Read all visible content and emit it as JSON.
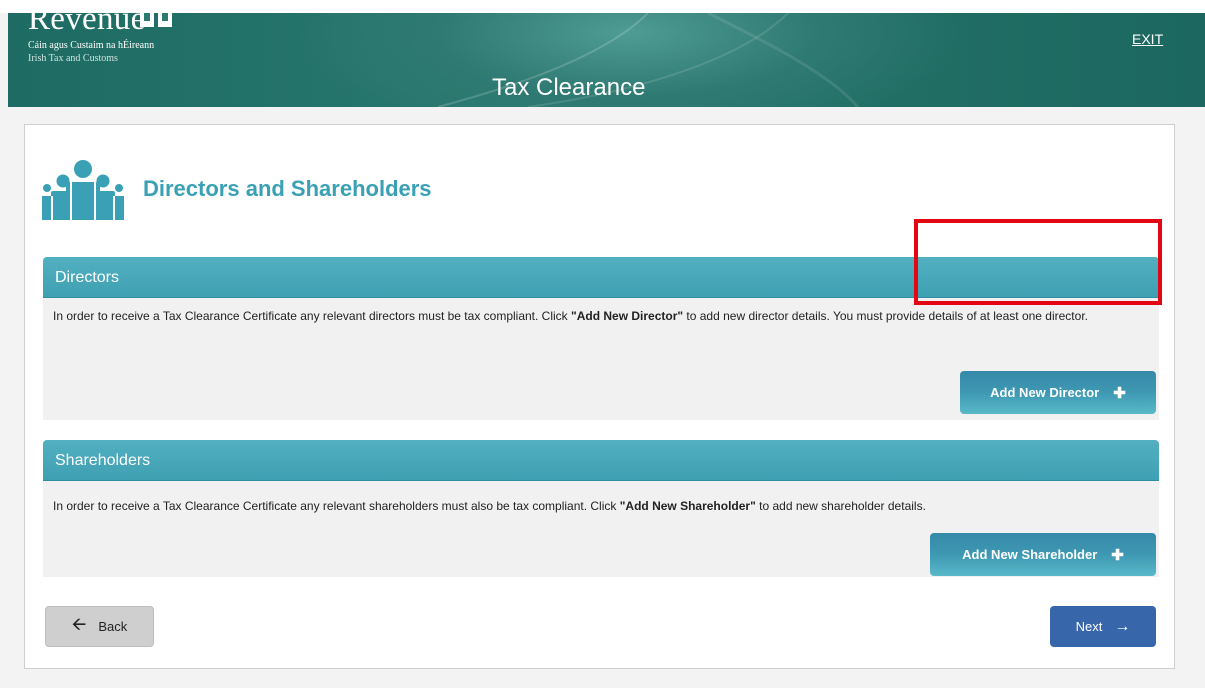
{
  "header": {
    "brand": "Revenue",
    "brand_sub_irish": "Cáin agus Custaim na hÉireann",
    "brand_sub_english": "Irish Tax and Customs",
    "app_title": "Tax Clearance",
    "exit_label": "EXIT"
  },
  "page": {
    "title": "Directors and Shareholders"
  },
  "directors": {
    "heading": "Directors",
    "text_before": "In order to receive a Tax Clearance Certificate any relevant directors must be tax compliant. Click ",
    "text_bold": "\"Add New Director\"",
    "text_after": " to add new director details. You must provide details of at least one director.",
    "button_label": "Add New Director",
    "button_icon": "plus-icon"
  },
  "shareholders": {
    "heading": "Shareholders",
    "text_before": "In order to receive a Tax Clearance Certificate any relevant shareholders must also be tax compliant. Click ",
    "text_bold": "\"Add New Shareholder\"",
    "text_after": " to add new shareholder details.",
    "button_label": "Add New Shareholder",
    "button_icon": "plus-icon"
  },
  "nav": {
    "back_label": "Back",
    "back_icon": "arrow-left-icon",
    "next_label": "Next",
    "next_icon": "arrow-right-icon"
  },
  "colors": {
    "header": "#1d6b62",
    "accent": "#3fa0b3",
    "title": "#3aa0b5",
    "next_button": "#3766ab",
    "highlight": "#e30613"
  }
}
